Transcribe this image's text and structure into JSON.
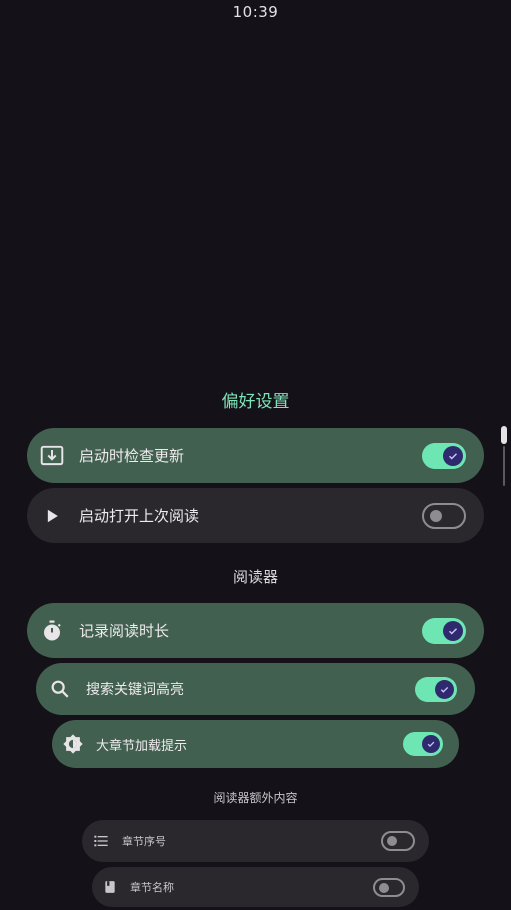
{
  "status_bar": {
    "time": "10:39"
  },
  "sections": {
    "preferences": "偏好设置",
    "reader": "阅读器",
    "reader_extra": "阅读器额外内容"
  },
  "rows": [
    {
      "label": "启动时检查更新",
      "icon": "download-box-icon",
      "enabled": true
    },
    {
      "label": "启动打开上次阅读",
      "icon": "play-icon",
      "enabled": false
    },
    {
      "label": "记录阅读时长",
      "icon": "timer-icon",
      "enabled": true
    },
    {
      "label": "搜索关键词高亮",
      "icon": "search-icon",
      "enabled": true
    },
    {
      "label": "大章节加载提示",
      "icon": "brightness-icon",
      "enabled": true
    },
    {
      "label": "章节序号",
      "icon": "list-icon",
      "enabled": false
    },
    {
      "label": "章节名称",
      "icon": "book-icon",
      "enabled": false
    }
  ],
  "colors": {
    "background": "#141218",
    "accent": "#6ee6b4",
    "row_on": "#42604f",
    "row_off": "#2a282d",
    "knob_on": "#2f2a6e"
  }
}
